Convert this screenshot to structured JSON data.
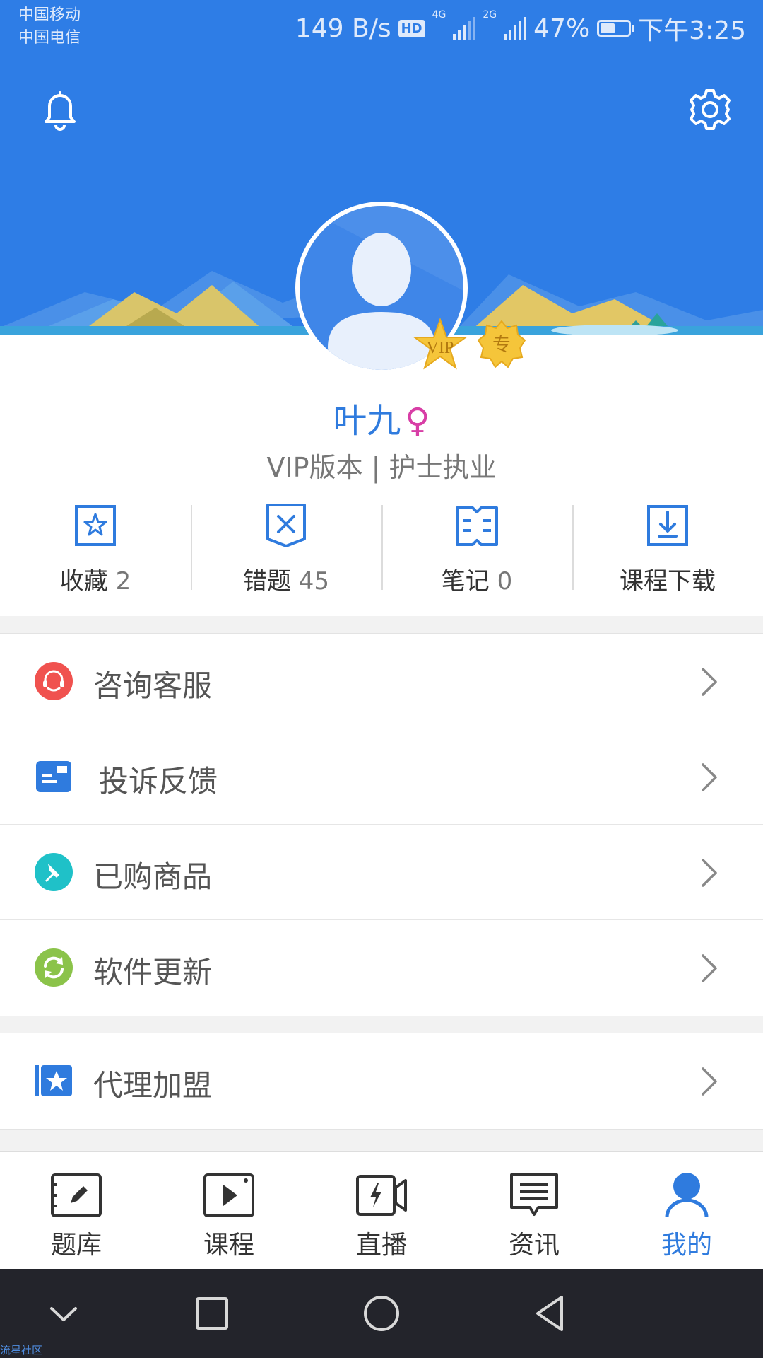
{
  "status_bar": {
    "carrier_1": "中国移动",
    "carrier_2": "中国电信",
    "speed": "149 B/s",
    "hd": "HD",
    "net_1": "4G",
    "net_2": "2G",
    "battery": "47%",
    "battery_level": 0.47,
    "time": "下午3:25"
  },
  "header": {
    "bell_icon": "bell-icon",
    "settings_icon": "gear-icon",
    "background_color": "#2e7de6"
  },
  "profile": {
    "name": "叶九",
    "gender_symbol": "♀",
    "subtitle": "VIP版本 | 护士执业",
    "badge_vip": "VIP",
    "badge_zhuan": "专"
  },
  "quick_actions": [
    {
      "icon": "star-bookmark-icon",
      "label": "收藏",
      "count": "2"
    },
    {
      "icon": "wrong-question-icon",
      "label": "错题",
      "count": "45"
    },
    {
      "icon": "notebook-icon",
      "label": "笔记",
      "count": "0"
    },
    {
      "icon": "download-icon",
      "label": "课程下载",
      "count": ""
    }
  ],
  "menu_group_1": [
    {
      "icon": "customer-service-icon",
      "label": "咨询客服",
      "color": "#f0524f"
    },
    {
      "icon": "feedback-card-icon",
      "label": "投诉反馈",
      "color": "#2f7bde"
    },
    {
      "icon": "purchased-tag-icon",
      "label": "已购商品",
      "color": "#1fc1c8"
    },
    {
      "icon": "refresh-update-icon",
      "label": "软件更新",
      "color": "#8bc34a"
    }
  ],
  "menu_group_2": [
    {
      "icon": "agent-star-icon",
      "label": "代理加盟",
      "color": "#2f7bde"
    }
  ],
  "tabbar": {
    "active_color": "#2f7bde",
    "tabs": [
      {
        "icon": "question-bank-icon",
        "label": "题库"
      },
      {
        "icon": "course-play-icon",
        "label": "课程"
      },
      {
        "icon": "live-camera-icon",
        "label": "直播"
      },
      {
        "icon": "news-message-icon",
        "label": "资讯"
      },
      {
        "icon": "profile-person-icon",
        "label": "我的",
        "active": true
      }
    ]
  },
  "navbar": {
    "buttons": [
      "chevron-down-icon",
      "recent-apps-icon",
      "home-icon",
      "back-icon"
    ]
  },
  "watermark": "流星社区"
}
